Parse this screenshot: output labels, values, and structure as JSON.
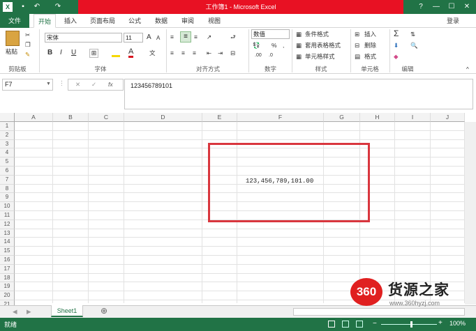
{
  "window": {
    "title": "工作簿1 - Microsoft Excel",
    "login": "登录",
    "help": "?",
    "min": "—",
    "max": "☐",
    "close": "✕"
  },
  "quick_access": {
    "save": "💾",
    "undo": "↶",
    "redo": "↷"
  },
  "tabs": [
    "文件",
    "开始",
    "插入",
    "页面布局",
    "公式",
    "数据",
    "审阅",
    "视图"
  ],
  "ribbon": {
    "clipboard": {
      "paste": "粘贴",
      "label": "剪贴板"
    },
    "font": {
      "name": "宋体",
      "size": "11",
      "label": "字体",
      "bold": "B",
      "italic": "I",
      "underline": "U",
      "grow": "A",
      "shrink": "A",
      "font_color": "A"
    },
    "alignment": {
      "label": "对齐方式"
    },
    "number": {
      "format": "数值",
      "percent": "%",
      "comma": ",",
      "label": "数字"
    },
    "styles": {
      "conditional": "条件格式",
      "table": "套用表格格式",
      "cell_styles": "单元格样式",
      "label": "样式"
    },
    "cells": {
      "insert": "插入",
      "delete": "删除",
      "format": "格式",
      "label": "单元格"
    },
    "editing": {
      "sum": "Σ",
      "label": "编辑"
    }
  },
  "formula_bar": {
    "name_box": "F7",
    "cancel": "✕",
    "enter": "✓",
    "fx": "fx",
    "content": "123456789101"
  },
  "columns": [
    "A",
    "B",
    "C",
    "D",
    "E",
    "F",
    "G",
    "H",
    "I",
    "J"
  ],
  "rows": [
    "1",
    "2",
    "3",
    "4",
    "5",
    "6",
    "7",
    "8",
    "9",
    "10",
    "11",
    "12",
    "13",
    "14",
    "15",
    "16",
    "17",
    "18",
    "19",
    "20",
    "21"
  ],
  "cell_f7": "123,456,789,101.00",
  "sheets": [
    "Sheet1"
  ],
  "add_sheet": "⊕",
  "status": {
    "ready": "就绪",
    "zoom": "100%"
  },
  "watermark": {
    "badge": "360",
    "text": "货源之家",
    "url": "www.360hyzj.com"
  }
}
